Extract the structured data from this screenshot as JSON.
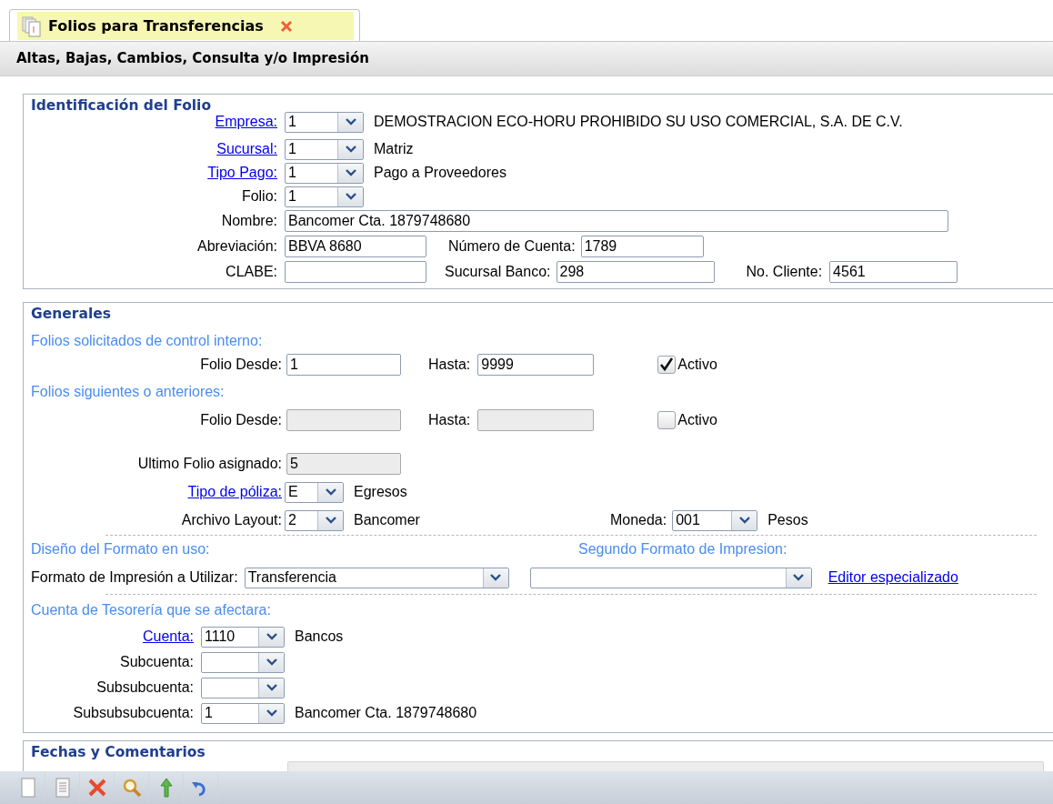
{
  "tab": {
    "title": "Folios para Transferencias",
    "selected": true
  },
  "subtitle": "Altas, Bajas, Cambios, Consulta y/o Impresión",
  "identificacion": {
    "legend": "Identificación del Folio",
    "selectors": [
      {
        "label": "Empresa:",
        "link": true,
        "value": "1",
        "description": "DEMOSTRACION ECO-HORU PROHIBIDO SU USO COMERCIAL, S.A. DE C.V."
      },
      {
        "label": "Sucursal:",
        "link": true,
        "value": "1",
        "description": "Matriz"
      },
      {
        "label": "Tipo Pago:",
        "link": true,
        "value": "1",
        "description": "Pago a Proveedores"
      },
      {
        "label": "Folio:",
        "link": false,
        "value": "1"
      }
    ],
    "nombre": {
      "label": "Nombre:",
      "value": "Bancomer Cta. 1879748680"
    },
    "abreviacion": {
      "label": "Abreviación:",
      "value": "BBVA 8680"
    },
    "numero_cuenta": {
      "label": "Número de Cuenta:",
      "value": "1789"
    },
    "clabe": {
      "label": "CLABE:"
    },
    "sucursal_banco": {
      "label": "Sucursal Banco:",
      "value": "298"
    },
    "no_cliente": {
      "label": "No. Cliente:",
      "value": "4561"
    }
  },
  "generales": {
    "legend": "Generales",
    "ranges": [
      {
        "heading": "Folios solicitados de control interno:",
        "desde_label": "Folio Desde:",
        "desde": "1",
        "hasta_label": "Hasta:",
        "hasta": "9999",
        "disabled": false,
        "checkbox_label": "Activo",
        "checked": true
      },
      {
        "heading": "Folios siguientes o anteriores:",
        "desde_label": "Folio Desde:",
        "hasta_label": "Hasta:",
        "disabled": true,
        "checkbox_label": "Activo",
        "checked": false
      }
    ],
    "ultimo_folio": {
      "label": "Ultimo Folio asignado:",
      "value": "5",
      "disabled": true
    },
    "tipo_poliza": {
      "label": "Tipo de póliza:",
      "link": true,
      "value": "E",
      "description": "Egresos"
    },
    "archivo_layout": {
      "label": "Archivo Layout:",
      "link": false,
      "value": "2",
      "description": "Bancomer"
    },
    "moneda": {
      "label": "Moneda:",
      "link": false,
      "value": "001",
      "description": "Pesos"
    },
    "formato": {
      "heading": "Diseño del Formato en uso:",
      "label": "Formato de Impresión a Utilizar:",
      "value": "Transferencia"
    },
    "segundo_formato": {
      "heading": "Segundo Formato de Impresion:"
    },
    "editor_link": "Editor especializado",
    "cuenta": {
      "heading": "Cuenta de Tesorería que se afectara:",
      "selectors": [
        {
          "label": "Cuenta:",
          "link": true,
          "value": "1110",
          "description": "Bancos"
        },
        {
          "label": "Subcuenta:",
          "link": false
        },
        {
          "label": "Subsubcuenta:",
          "link": false
        },
        {
          "label": "Subsubsubcuenta:",
          "link": false,
          "value": "1",
          "description": "Bancomer Cta. 1879748680"
        }
      ]
    }
  },
  "fechas": {
    "legend": "Fechas y Comentarios"
  }
}
